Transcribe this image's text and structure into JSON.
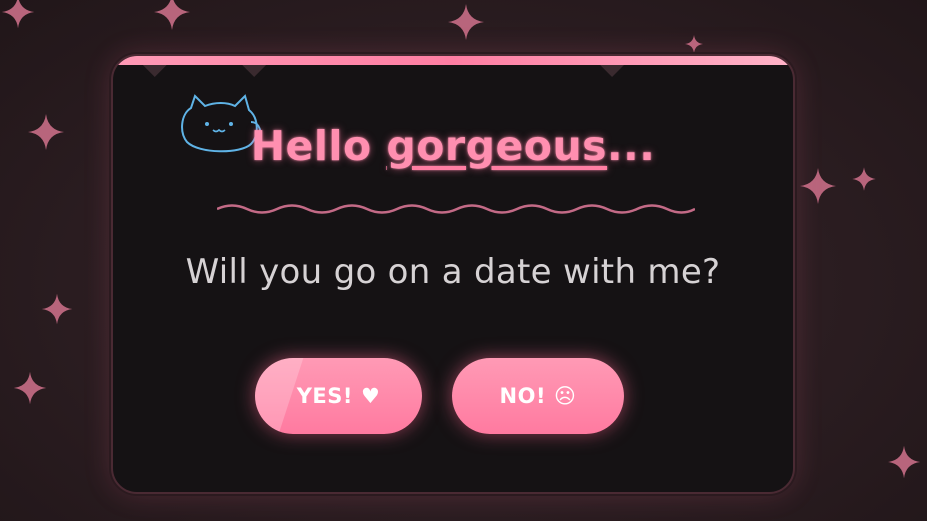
{
  "title": {
    "prefix": "Hello ",
    "highlight": "gorgeous",
    "suffix": "..."
  },
  "question": "Will you go on a date with me?",
  "buttons": {
    "yes": {
      "label": "YES!",
      "icon": "♥"
    },
    "no": {
      "label": "NO!",
      "icon": "☹"
    }
  },
  "colors": {
    "accent": "#ff8fb0",
    "button": "#ff7ea3",
    "card": "#151214",
    "background": "#2a1c20",
    "sparkle": "#b8657c",
    "cat": "#5fb3e6"
  }
}
